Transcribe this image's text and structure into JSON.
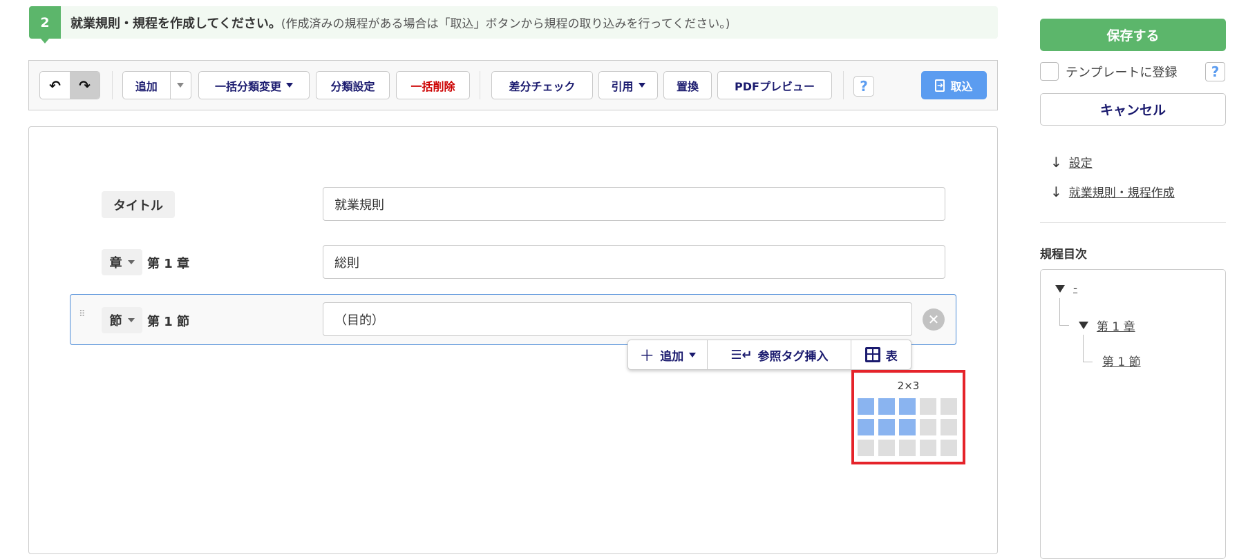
{
  "header": {
    "step": "2",
    "title": "就業規則・規程を作成してください。",
    "note": "(作成済みの規程がある場合は「取込」ボタンから規程の取り込みを行ってください。)"
  },
  "toolbar": {
    "add": "追加",
    "bulk_category": "一括分類変更",
    "category_settings": "分類設定",
    "bulk_delete": "一括削除",
    "diff_check": "差分チェック",
    "quote": "引用",
    "replace": "置換",
    "pdf_preview": "PDFプレビュー",
    "help": "?",
    "import": "取込"
  },
  "editor": {
    "title_label": "タイトル",
    "title_value": "就業規則",
    "chapter_type": "章",
    "chapter_number": "第 1 章",
    "chapter_value": "総則",
    "section_type": "節",
    "section_number": "第 1 節",
    "section_value": "（目的）"
  },
  "popup": {
    "add": "追加",
    "ref_tag": "参照タグ挿入",
    "table": "表"
  },
  "table_picker": {
    "label": "2×3",
    "rows": 3,
    "cols": 5,
    "selected_rows": 2,
    "selected_cols": 3
  },
  "sidebar": {
    "save": "保存する",
    "template_label": "テンプレートに登録",
    "help": "?",
    "cancel": "キャンセル",
    "links": [
      "設定",
      "就業規則・規程作成"
    ],
    "toc_title": "規程目次",
    "toc": {
      "root": "-",
      "chapter": "第 1 章",
      "section": "第 1 節"
    }
  },
  "colors": {
    "green": "#5cb66b",
    "navy": "#1a1a6e",
    "red": "#cc0000",
    "blue": "#5b9cf0",
    "highlight": "#e5232a"
  }
}
